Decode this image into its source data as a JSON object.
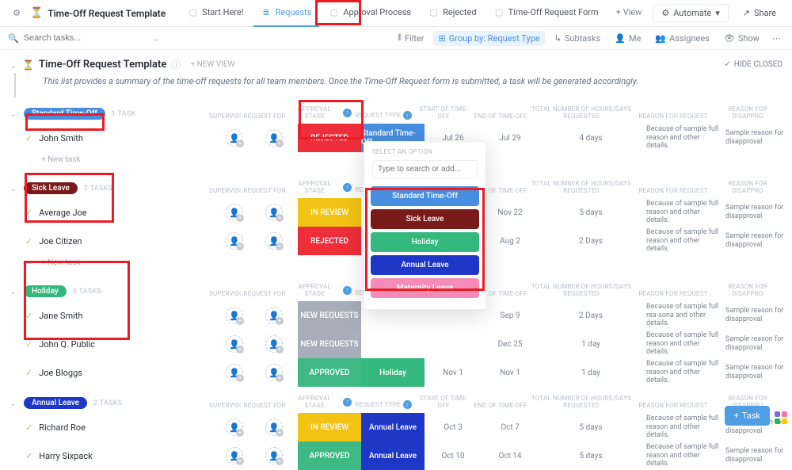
{
  "colors": {
    "standard": "#478ee0",
    "sick": "#7a1b1b",
    "holiday": "#34b87e",
    "annual": "#1f37c6",
    "maternity": "#f48cb7",
    "rejected": "#ee2f3a",
    "inreview": "#f2c313",
    "newreq": "#a7aeba",
    "approved": "#3fb984"
  },
  "header": {
    "title": "Time-Off Request Template",
    "tabs": [
      "Start Here!",
      "Requests",
      "Approval Process",
      "Rejected",
      "Time-Off Request Form"
    ],
    "add_view": "+  View",
    "automate": "Automate",
    "share": "Share"
  },
  "toolbar": {
    "search_placeholder": "Search tasks...",
    "filter": "Filter",
    "group_by": "Group by: Request Type",
    "subtasks": "Subtasks",
    "me": "Me",
    "assignees": "Assignees",
    "show": "Show"
  },
  "list": {
    "title": "Time-Off Request Template",
    "new_view": "+ NEW VIEW",
    "hide_closed": "HIDE CLOSED",
    "description": "This list provides a summary of the time-off requests for all team members. Once the Time-Off Request form is submitted, a task will be generated accordingly."
  },
  "columns": {
    "supervisor": "SUPERVISOR",
    "request_for": "REQUEST FOR",
    "approval_stage": "APPROVAL STAGE",
    "request_type": "REQUEST TYPE",
    "start": "START OF TIME-OFF",
    "end": "END OF TIME-OFF",
    "total": "TOTAL NUMBER OF HOURS/DAYS REQUESTED",
    "reason_req": "REASON FOR REQUEST",
    "reason_dis": "REASON FOR DISAPPRO"
  },
  "newtask_label": "+ New task",
  "groups": [
    {
      "name": "Standard Time-Off",
      "color": "#478ee0",
      "count": "1 TASK",
      "rows": [
        {
          "name": "John Smith",
          "stage": "REJECTED",
          "stage_color": "#ee2f3a",
          "type": "Standard Time-Off",
          "type_color": "#478ee0",
          "start": "Jul 26",
          "end": "Jul 29",
          "total": "4 days",
          "reason": "Because of sample full reason and other details.",
          "dis": "Sample reason for disapproval"
        }
      ],
      "newtask": true
    },
    {
      "name": "Sick Leave",
      "color": "#7a1b1b",
      "count": "2 TASKS",
      "rows": [
        {
          "name": "Average Joe",
          "stage": "IN REVIEW",
          "stage_color": "#f2c313",
          "type": "",
          "type_color": "",
          "start": "",
          "end": "Nov 22",
          "total": "5 days",
          "reason": "Because of sample full reason and other details.",
          "dis": "Sample reason for disapproval"
        },
        {
          "name": "Joe Citizen",
          "stage": "REJECTED",
          "stage_color": "#ee2f3a",
          "type": "",
          "type_color": "",
          "start": "",
          "end": "Aug 2",
          "total": "2 Days",
          "reason": "Because of sample full reason and other details.",
          "dis": "Sample reason for disapproval"
        }
      ],
      "newtask": true
    },
    {
      "name": "Holiday",
      "color": "#34b87e",
      "count": "3 TASKS",
      "rows": [
        {
          "name": "Jane Smith",
          "stage": "NEW REQUESTS",
          "stage_color": "#a7aeba",
          "type": "",
          "type_color": "",
          "start": "",
          "end": "Sep 9",
          "total": "2 Days",
          "reason": "Because of sample full rea-sona and other details.",
          "dis": "Sample reason for disapproval"
        },
        {
          "name": "John Q. Public",
          "stage": "NEW REQUESTS",
          "stage_color": "#a7aeba",
          "type": "",
          "type_color": "",
          "start": "",
          "end": "Dec 25",
          "total": "1 day",
          "reason": "Because of sample full reason and other details.",
          "dis": "Sample reason for disapproval"
        },
        {
          "name": "Joe Bloggs",
          "stage": "APPROVED",
          "stage_color": "#3fb984",
          "type": "Holiday",
          "type_color": "#34b87e",
          "start": "Nov 1",
          "end": "Nov 1",
          "total": "1 day",
          "reason": "Because of sample full reason and other details.",
          "dis": "Sample reason for disapproval"
        }
      ],
      "newtask": false
    },
    {
      "name": "Annual Leave",
      "color": "#1f37c6",
      "count": "2 TASKS",
      "rows": [
        {
          "name": "Richard Roe",
          "stage": "IN REVIEW",
          "stage_color": "#f2c313",
          "type": "Annual Leave",
          "type_color": "#1f37c6",
          "start": "Oct 3",
          "end": "Oct 7",
          "total": "5 days",
          "reason": "Because of sample full reason and other details.",
          "dis": "Sample reason for disapproval"
        },
        {
          "name": "Harry Sixpack",
          "stage": "APPROVED",
          "stage_color": "#3fb984",
          "type": "Annual Leave",
          "type_color": "#1f37c6",
          "start": "Oct 10",
          "end": "Oct 14",
          "total": "5 days",
          "reason": "Because of sample full reason and other details.",
          "dis": "Sample reason for disapproval"
        }
      ],
      "newtask": false
    }
  ],
  "dropdown": {
    "header": "SELECT AN OPTION",
    "placeholder": "Type to search or add...",
    "options": [
      {
        "label": "Standard Time-Off",
        "color": "#478ee0"
      },
      {
        "label": "Sick Leave",
        "color": "#7a1b1b"
      },
      {
        "label": "Holiday",
        "color": "#34b87e"
      },
      {
        "label": "Annual Leave",
        "color": "#1f37c6"
      },
      {
        "label": "Maternity Leave",
        "color": "#f48cb7"
      }
    ]
  },
  "fab": "Task"
}
